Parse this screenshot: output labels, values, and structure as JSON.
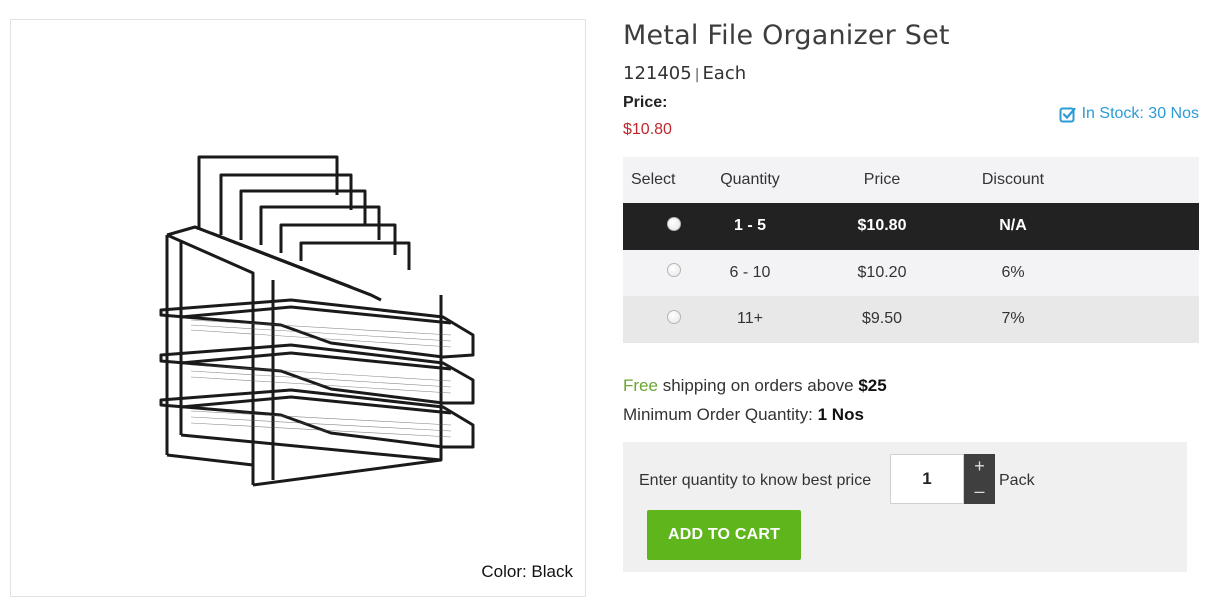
{
  "product": {
    "title": "Metal File Organizer Set",
    "sku": "121405",
    "sep": "|",
    "unit": "Each",
    "price_label": "Price:",
    "price": "$10.80",
    "color_text": "Color: Black",
    "image_icon": "file-organizer-image"
  },
  "stock": {
    "icon": "check-square-icon",
    "text": "In Stock: 30 Nos",
    "color": "#2b9bd6"
  },
  "tier_table": {
    "headers": [
      "Select",
      "Quantity",
      "Price",
      "Discount"
    ],
    "rows": [
      {
        "quantity": "1 - 5",
        "price": "$10.80",
        "discount": "N/A",
        "selected": true
      },
      {
        "quantity": "6 - 10",
        "price": "$10.20",
        "discount": "6%",
        "selected": false
      },
      {
        "quantity": "11+",
        "price": "$9.50",
        "discount": "7%",
        "selected": false
      }
    ]
  },
  "shipping": {
    "free": "Free",
    "text": " shipping on orders above ",
    "amount": "$25"
  },
  "moq": {
    "label": "Minimum Order Quantity: ",
    "value": "1 Nos"
  },
  "cart": {
    "prompt": "Enter quantity to know best price",
    "quantity": "1",
    "plus": "+",
    "minus": "–",
    "unit": "Pack",
    "button": "ADD TO CART",
    "button_color": "#5fb61c"
  },
  "colors": {
    "price_red": "#c0272d",
    "free_green": "#6aa531",
    "selected_row": "#222222"
  }
}
